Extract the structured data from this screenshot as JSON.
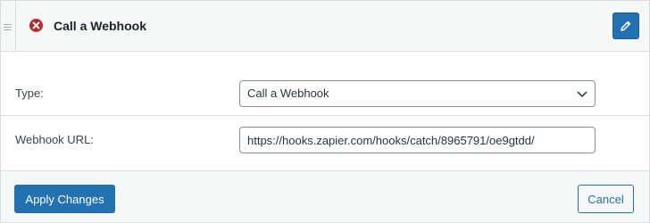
{
  "header": {
    "title": "Call a Webhook",
    "status_icon": "error-circle-icon",
    "edit_icon": "pencil-icon",
    "status_color": "#b32d2e"
  },
  "fields": {
    "type": {
      "label": "Type:",
      "selected_value": "Call a Webhook"
    },
    "webhook_url": {
      "label": "Webhook URL:",
      "value": "https://hooks.zapier.com/hooks/catch/8965791/oe9gtdd/"
    }
  },
  "footer": {
    "apply_label": "Apply Changes",
    "cancel_label": "Cancel"
  },
  "colors": {
    "accent": "#2271b1",
    "background": "#f6f7f7"
  }
}
